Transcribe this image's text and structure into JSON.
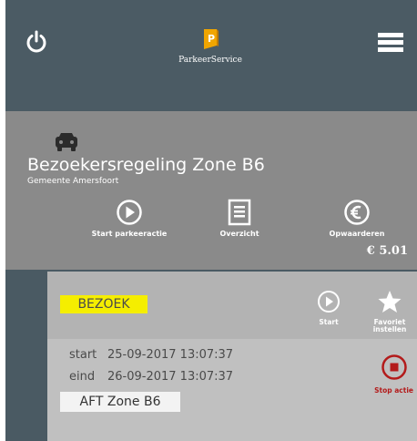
{
  "header": {
    "logo_text": "ParkeerService",
    "logo_letter": "P",
    "icons": {
      "power": "power-icon",
      "menu": "hamburger-menu-icon",
      "logo": "parking-sign-icon"
    }
  },
  "zone": {
    "title": "Bezoekersregeling Zone B6",
    "subtitle": "Gemeente Amersfoort",
    "car_icon": "car-icon",
    "actions": [
      {
        "label": "Start parkeeractie",
        "icon": "play-circle-icon"
      },
      {
        "label": "Overzicht",
        "icon": "list-document-icon"
      },
      {
        "label": "Opwaarderen",
        "icon": "euro-circle-icon"
      }
    ],
    "balance": "€ 5.01"
  },
  "session": {
    "badge": "BEZOEK",
    "start_label": "Start",
    "favorite_label_1": "Favoriet",
    "favorite_label_2": "instellen",
    "start_key": "start",
    "start_value": "25-09-2017 13:07:37",
    "end_key": "eind",
    "end_value": "26-09-2017 13:07:37",
    "plate": "AFT Zone B6",
    "stop_label": "Stop actie"
  },
  "colors": {
    "header_bg": "#4b5b64",
    "zone_bg": "#8a8a8a",
    "session_bg": "#c0c0c0",
    "badge_bg": "#f5ee00",
    "stop_red": "#b31b1b",
    "logo_orange": "#f0a500"
  }
}
